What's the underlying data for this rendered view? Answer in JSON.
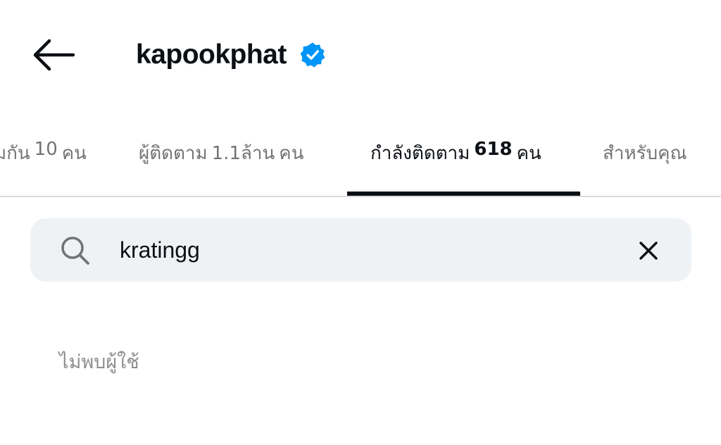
{
  "header": {
    "back_icon": "arrow-left-icon",
    "title": "kapookphat",
    "verified_icon": "verified-badge-icon",
    "verified_color": "#0095f6"
  },
  "tabs": [
    {
      "prefix": "มกัน",
      "count": "10",
      "suffix": "คน",
      "active": false
    },
    {
      "prefix": "ผู้ติดตาม",
      "count": "1.1ล้าน",
      "suffix": "คน",
      "active": false
    },
    {
      "prefix": "กำลังติดตาม",
      "count": "618",
      "suffix": "คน",
      "active": true
    },
    {
      "prefix": "สำหรับคุณ",
      "count": "",
      "suffix": "",
      "active": false
    }
  ],
  "search": {
    "icon": "search-icon",
    "value": "kratingg",
    "clear_icon": "close-icon"
  },
  "results": {
    "empty_message": "ไม่พบผู้ใช้"
  },
  "colors": {
    "text_primary": "#0c1014",
    "text_secondary": "#737373",
    "search_bg": "#eff2f5",
    "divider": "#dbdbdb"
  }
}
